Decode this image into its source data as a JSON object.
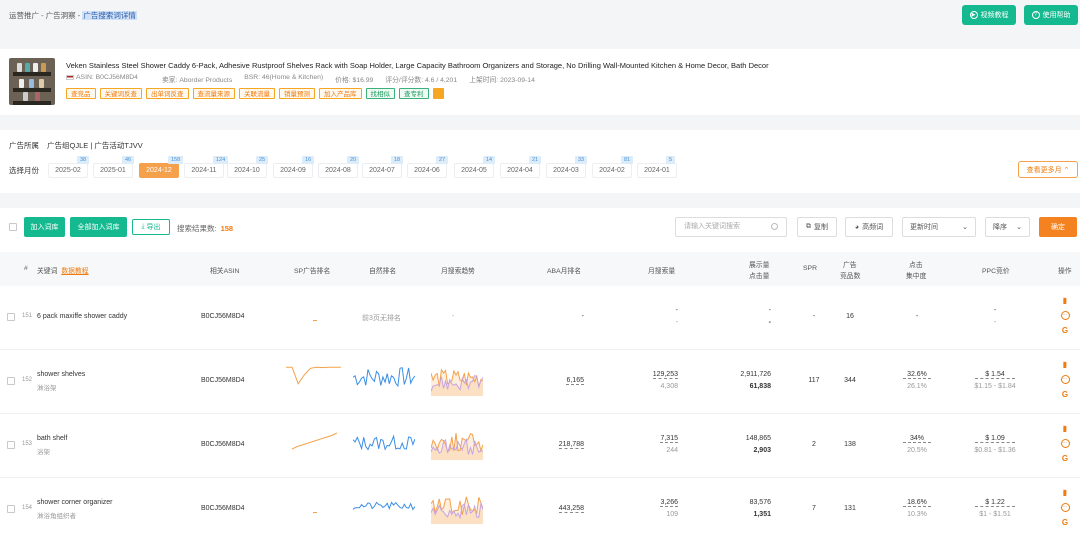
{
  "breadcrumb": {
    "item1": "运营推广",
    "item2": "广告洞察",
    "current": "广告搜索词详情",
    "sep": "-"
  },
  "header": {
    "video_btn": "视频教程",
    "help_btn": "使用帮助"
  },
  "product": {
    "title": "Veken Stainless Steel Shower Caddy 6-Pack, Adhesive Rustproof Shelves Rack with Soap Holder, Large Capacity Bathroom Organizers and Storage, No Drilling Wall-Mounted Kitchen & Home Decor, Bath Decor",
    "asin": "ASIN: B0CJ56M8D4",
    "seller": "卖家: Aborder Products",
    "bsr": "BSR: 46(Home & Kitchen)",
    "price": "价格: $16.99",
    "rating": "评分/评分数: 4.6 / 4,201",
    "launch": "上架时间: 2023-09-14",
    "tags": [
      "查竞品",
      "关键词反查",
      "出单词反查",
      "查流量来源",
      "关联流量",
      "销量预测",
      "加入产品库"
    ],
    "green_tags": [
      "找相似",
      "查专利"
    ]
  },
  "filters": {
    "owner_label": "广告所属",
    "owner_value": "广告组QJLE | 广告活动TJVV",
    "month_label": "选择月份",
    "months": [
      {
        "label": "2025-02",
        "badge": "38"
      },
      {
        "label": "2025-01",
        "badge": "46"
      },
      {
        "label": "2024-12",
        "badge": "158"
      },
      {
        "label": "2024-11",
        "badge": "124"
      },
      {
        "label": "2024-10",
        "badge": "25"
      },
      {
        "label": "2024-09",
        "badge": "16"
      },
      {
        "label": "2024-08",
        "badge": "20"
      },
      {
        "label": "2024-07",
        "badge": "18"
      },
      {
        "label": "2024-06",
        "badge": "27"
      },
      {
        "label": "2024-05",
        "badge": "14"
      },
      {
        "label": "2024-04",
        "badge": "21"
      },
      {
        "label": "2024-03",
        "badge": "33"
      },
      {
        "label": "2024-02",
        "badge": "81"
      },
      {
        "label": "2024-01",
        "badge": "5"
      }
    ],
    "selected_month": "2024-12",
    "more_months": "查看更多月 ⌃"
  },
  "toolbar": {
    "add_btn": "加入词库",
    "add_all_btn": "全部加入词库",
    "export_btn": "导出",
    "result_label": "搜索结果数:",
    "result_count": "158",
    "search_placeholder": "请输入关键词搜索",
    "copy_btn": "复制",
    "freq_btn": "高频词",
    "sort_field": "更新时间",
    "sort_order": "降序",
    "confirm_btn": "确定"
  },
  "table": {
    "headers": {
      "index": "#",
      "keyword": "关键词",
      "keyword_tutorial": "数据教程",
      "asin": "相关ASIN",
      "sp_rank": "SP广告排名",
      "natural_rank": "自然排名",
      "trend": "月搜索趋势",
      "aba": "ABA月排名",
      "monthly_search": "月搜索量",
      "impressions_1": "展示量",
      "impressions_2": "点击量",
      "spr": "SPR",
      "products_1": "广告",
      "products_2": "竞品数",
      "click_1": "点击",
      "click_2": "集中度",
      "ppc": "PPC竞价",
      "ops": "操作"
    },
    "rows": [
      {
        "index": "151",
        "keyword": "6 pack maxiffe shower caddy",
        "cn": "",
        "asin": "B0CJ56M8D4",
        "natural": "前3页无排名",
        "trend_empty": "-",
        "aba": "-",
        "search": "-",
        "search_sub": "-",
        "impr": "-",
        "clicks": "-",
        "spr": "-",
        "products": "16",
        "click_conc": "-",
        "click_conc_sub": "",
        "ppc": "-",
        "ppc_range": "-"
      },
      {
        "index": "152",
        "keyword": "shower shelves",
        "cn": "淋浴架",
        "asin": "B0CJ56M8D4",
        "natural": "",
        "trend_empty": "",
        "aba": "6,165",
        "search": "129,253",
        "search_sub": "4,308",
        "impr": "2,911,726",
        "clicks": "61,838",
        "spr": "117",
        "products": "344",
        "click_conc": "32.6%",
        "click_conc_sub": "26.1%",
        "ppc": "$ 1.54",
        "ppc_range": "$1.15 - $1.84"
      },
      {
        "index": "153",
        "keyword": "bath shelf",
        "cn": "浴架",
        "asin": "B0CJ56M8D4",
        "natural": "",
        "trend_empty": "",
        "aba": "218,788",
        "search": "7,315",
        "search_sub": "244",
        "impr": "148,865",
        "clicks": "2,903",
        "spr": "2",
        "products": "138",
        "click_conc": "34%",
        "click_conc_sub": "20.5%",
        "ppc": "$ 1.09",
        "ppc_range": "$0.81 - $1.36"
      },
      {
        "index": "154",
        "keyword": "shower corner organizer",
        "cn": "淋浴角组织者",
        "asin": "B0CJ56M8D4",
        "natural": "",
        "trend_empty": "",
        "aba": "443,258",
        "search": "3,266",
        "search_sub": "109",
        "impr": "83,576",
        "clicks": "1,351",
        "spr": "7",
        "products": "131",
        "click_conc": "18.6%",
        "click_conc_sub": "10.3%",
        "ppc": "$ 1.22",
        "ppc_range": "$1 - $1.51"
      }
    ]
  },
  "colors": {
    "green": "#14b98f",
    "orange": "#f58220",
    "blue": "#3a8ee6"
  }
}
